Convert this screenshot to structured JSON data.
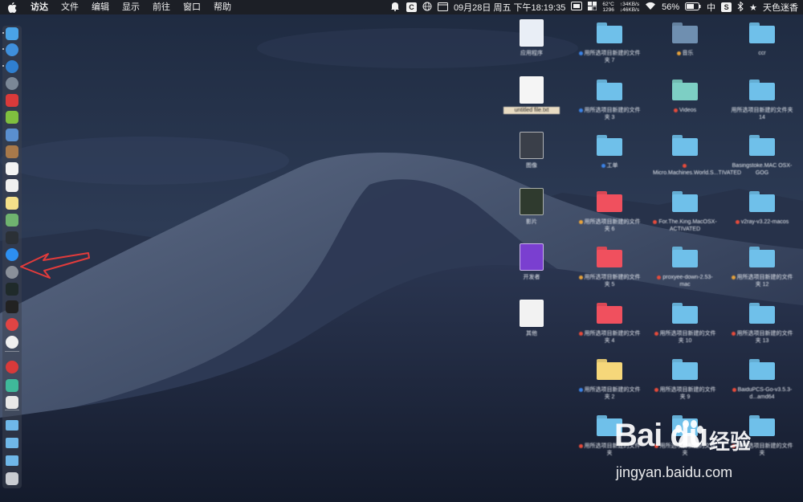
{
  "menubar": {
    "app_name": "访达",
    "menus": [
      "文件",
      "编辑",
      "显示",
      "前往",
      "窗口",
      "帮助"
    ],
    "status": {
      "temp": "62°C",
      "fan": "1296",
      "net_up": "↑34KB/s",
      "net_down": "↓46KB/s",
      "datetime": "09月28日 周五 下午18:19:35",
      "battery": "56%",
      "input": "中",
      "user": "天色迷香"
    }
  },
  "dock": {
    "items": [
      {
        "name": "finder-icon",
        "color": "#4aa3e6"
      },
      {
        "name": "safari-compass-icon",
        "color": "#3f8fdb"
      },
      {
        "name": "safari-icon",
        "color": "#2f7fd0"
      },
      {
        "name": "launchpad-rocket-icon",
        "color": "#7b8796"
      },
      {
        "name": "red-app-icon",
        "color": "#d93a3a"
      },
      {
        "name": "android-icon",
        "color": "#7fbf3f"
      },
      {
        "name": "preview-icon",
        "color": "#5a8fcf"
      },
      {
        "name": "notes-brown-icon",
        "color": "#a8794a"
      },
      {
        "name": "calendar-icon",
        "color": "#f3f3f3"
      },
      {
        "name": "textedit-icon",
        "color": "#f0f0f0"
      },
      {
        "name": "notes-icon",
        "color": "#f4e08a"
      },
      {
        "name": "maps-icon",
        "color": "#6fb36f"
      },
      {
        "name": "activity-monitor-icon",
        "color": "#2b3036"
      },
      {
        "name": "app-store-icon",
        "color": "#2d8ff0"
      },
      {
        "name": "system-preferences-icon",
        "color": "#8a9099"
      },
      {
        "name": "activity-icon",
        "color": "#1f2a2a"
      },
      {
        "name": "terminal-icon",
        "color": "#222222"
      },
      {
        "name": "vivaldi-icon",
        "color": "#e04444"
      },
      {
        "name": "yandex-icon",
        "color": "#f0f0f0"
      },
      {
        "name": "netease-music-icon",
        "color": "#d83a3a"
      },
      {
        "name": "green-app-icon",
        "color": "#3fb89a"
      },
      {
        "name": "document-icon",
        "color": "#e8e8e8"
      },
      {
        "name": "folder-icon",
        "color": "#6fb7e8"
      },
      {
        "name": "folder-icon-2",
        "color": "#6fb7e8"
      },
      {
        "name": "downloads-folder-icon",
        "color": "#6fb7e8"
      },
      {
        "name": "trash-icon",
        "color": "#c9ccd1"
      }
    ]
  },
  "desktop": {
    "icons": [
      {
        "col": 0,
        "row": 0,
        "kind": "thumb",
        "color": "#e9eef6",
        "label": "应用程序"
      },
      {
        "col": 1,
        "row": 0,
        "kind": "folder",
        "color": "#6fc0ea",
        "tag": "#3b82e6",
        "label": "用所选项目新建的文件夹 7"
      },
      {
        "col": 2,
        "row": 0,
        "kind": "folder",
        "color": "#6f8fb0",
        "tag": "#e6a23b",
        "label": "音乐"
      },
      {
        "col": 3,
        "row": 0,
        "kind": "folder",
        "color": "#6fc0ea",
        "tag": "",
        "label": "ccr"
      },
      {
        "col": 0,
        "row": 1,
        "kind": "thumb",
        "color": "#f5f5f5",
        "label": "untitled file.txt"
      },
      {
        "col": 1,
        "row": 1,
        "kind": "folder",
        "color": "#6fc0ea",
        "tag": "#3b82e6",
        "label": "用所选项目新建的文件夹 3"
      },
      {
        "col": 2,
        "row": 1,
        "kind": "folder",
        "color": "#7dcfc4",
        "tag": "#e64b3b",
        "label": "Videos"
      },
      {
        "col": 3,
        "row": 1,
        "kind": "folder",
        "color": "#6fc0ea",
        "tag": "",
        "label": "用所选项目新建的文件夹 14"
      },
      {
        "col": 0,
        "row": 2,
        "kind": "thumb",
        "color": "#3a3f49",
        "label": "图像"
      },
      {
        "col": 1,
        "row": 2,
        "kind": "folder",
        "color": "#6fc0ea",
        "tag": "#3b82e6",
        "label": "工单"
      },
      {
        "col": 2,
        "row": 2,
        "kind": "folder",
        "color": "#6fc0ea",
        "tag": "#e64b3b",
        "label": "Micro.Machines.World.S...TIVATED"
      },
      {
        "col": 3,
        "row": 2,
        "kind": "folder",
        "color": "#6fc0ea",
        "tag": "",
        "label": "Basingstoke.MAC OSX-GOG"
      },
      {
        "col": 0,
        "row": 3,
        "kind": "thumb",
        "color": "#2f3a2e",
        "label": "影片"
      },
      {
        "col": 1,
        "row": 3,
        "kind": "folder",
        "color": "#f0505e",
        "tag": "#e6a23b",
        "label": "用所选项目新建的文件夹 6"
      },
      {
        "col": 2,
        "row": 3,
        "kind": "folder",
        "color": "#6fc0ea",
        "tag": "#e64b3b",
        "label": "For.The.King.MacOSX-ACTIVATED"
      },
      {
        "col": 3,
        "row": 3,
        "kind": "folder",
        "color": "#6fc0ea",
        "tag": "#e64b3b",
        "label": "v2ray-v3.22-macos"
      },
      {
        "col": 0,
        "row": 4,
        "kind": "thumb",
        "color": "#7a3fd0",
        "label": "开发者"
      },
      {
        "col": 1,
        "row": 4,
        "kind": "folder",
        "color": "#f0505e",
        "tag": "#e6a23b",
        "label": "用所选项目新建的文件夹 5"
      },
      {
        "col": 2,
        "row": 4,
        "kind": "folder",
        "color": "#6fc0ea",
        "tag": "#e64b3b",
        "label": "proxyee-down-2.53-mac"
      },
      {
        "col": 3,
        "row": 4,
        "kind": "folder",
        "color": "#6fc0ea",
        "tag": "#e6a23b",
        "label": "用所选项目新建的文件夹 12"
      },
      {
        "col": 0,
        "row": 5,
        "kind": "thumb",
        "color": "#f2f2f2",
        "label": "其他"
      },
      {
        "col": 1,
        "row": 5,
        "kind": "folder",
        "color": "#f0505e",
        "tag": "#e64b3b",
        "label": "用所选项目新建的文件夹 4"
      },
      {
        "col": 2,
        "row": 5,
        "kind": "folder",
        "color": "#6fc0ea",
        "tag": "#e64b3b",
        "label": "用所选项目新建的文件夹 10"
      },
      {
        "col": 3,
        "row": 5,
        "kind": "folder",
        "color": "#6fc0ea",
        "tag": "#e64b3b",
        "label": "用所选项目新建的文件夹 13"
      },
      {
        "col": 1,
        "row": 6,
        "kind": "folder",
        "color": "#f6d77a",
        "tag": "#3b82e6",
        "label": "用所选项目新建的文件夹 2"
      },
      {
        "col": 2,
        "row": 6,
        "kind": "folder",
        "color": "#6fc0ea",
        "tag": "#e64b3b",
        "label": "用所选项目新建的文件夹 9"
      },
      {
        "col": 3,
        "row": 6,
        "kind": "folder",
        "color": "#6fc0ea",
        "tag": "#e64b3b",
        "label": "BaiduPCS-Go-v3.5.3-d...amd64"
      },
      {
        "col": 1,
        "row": 7,
        "kind": "folder",
        "color": "#6fc0ea",
        "tag": "#e64b3b",
        "label": "用所选项目新建的文件夹"
      },
      {
        "col": 2,
        "row": 7,
        "kind": "folder",
        "color": "#6fc0ea",
        "tag": "#e64b3b",
        "label": "用所选项目新建的文件夹"
      },
      {
        "col": 3,
        "row": 7,
        "kind": "folder",
        "color": "#6fc0ea",
        "tag": "#e64b3b",
        "label": "用所选项目新建的文件夹"
      }
    ]
  },
  "watermark": {
    "brand": "Bai du",
    "jingyan": "经验",
    "url": "jingyan.baidu.com"
  }
}
